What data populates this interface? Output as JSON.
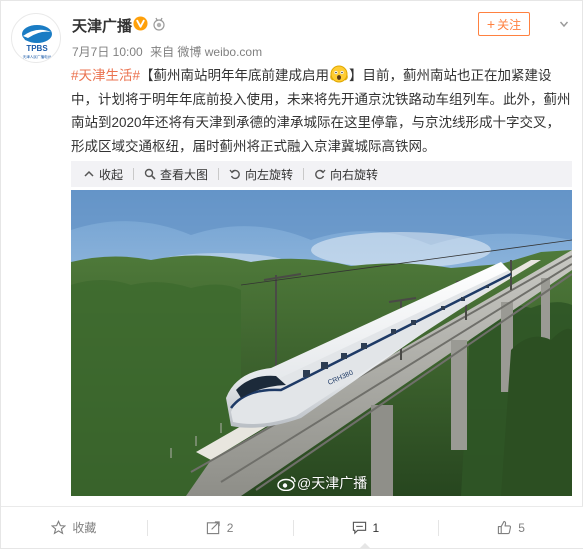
{
  "post": {
    "author": "天津广播",
    "avatar_brand": "TPBS",
    "avatar_subtitle": "天津人民广播电台",
    "date": "7月7日 10:00",
    "source": "来自 微博 weibo.com",
    "follow_label": "关注",
    "hashtag": "#天津生活#",
    "title": "【蓟州南站明年年底前建成启用",
    "body_1": "】目前，蓟州南站也正在加紧建设中，计划将于明年年底前投入使用，未来将先开通京沈铁路动车组列车。此外，蓟州南站到2020年还将有天津到承德的津承城际在这里停靠，与京沈线形成十字交叉，形成区域交通枢纽，届时蓟州将正式融入京津冀城际高铁网。",
    "emoji": "scared-face-emoji"
  },
  "toolbar": {
    "collapse": "收起",
    "view_large": "查看大图",
    "rotate_left": "向左旋转",
    "rotate_right": "向右旋转"
  },
  "image": {
    "watermark": "@天津广播",
    "train_number": "CRH380"
  },
  "actions": {
    "favorite": "收藏",
    "repost_count": "2",
    "comment_count": "1",
    "like_count": "5"
  },
  "colors": {
    "accent": "#ff8140",
    "link": "#eb7350",
    "verified": "#ffa00a"
  }
}
